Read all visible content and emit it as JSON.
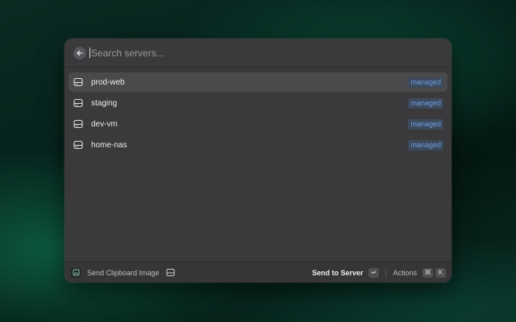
{
  "search": {
    "placeholder": "Search servers..."
  },
  "servers": [
    {
      "name": "prod-web",
      "badge": "managed",
      "selected": true
    },
    {
      "name": "staging",
      "badge": "managed",
      "selected": false
    },
    {
      "name": "dev-vm",
      "badge": "managed",
      "selected": false
    },
    {
      "name": "home-nas",
      "badge": "managed",
      "selected": false
    }
  ],
  "footer": {
    "left_label": "Send Clipboard Image",
    "primary_action": "Send to Server",
    "primary_key": "↵",
    "actions_label": "Actions",
    "actions_keys": [
      "⌘",
      "K"
    ]
  },
  "icons": {
    "back": "arrow-left-icon",
    "server": "server-icon",
    "app": "clipboard-image-icon"
  },
  "colors": {
    "badge_text": "#6e9de0",
    "badge_bg": "#3d4a5c",
    "panel": "#3a3a3c"
  }
}
